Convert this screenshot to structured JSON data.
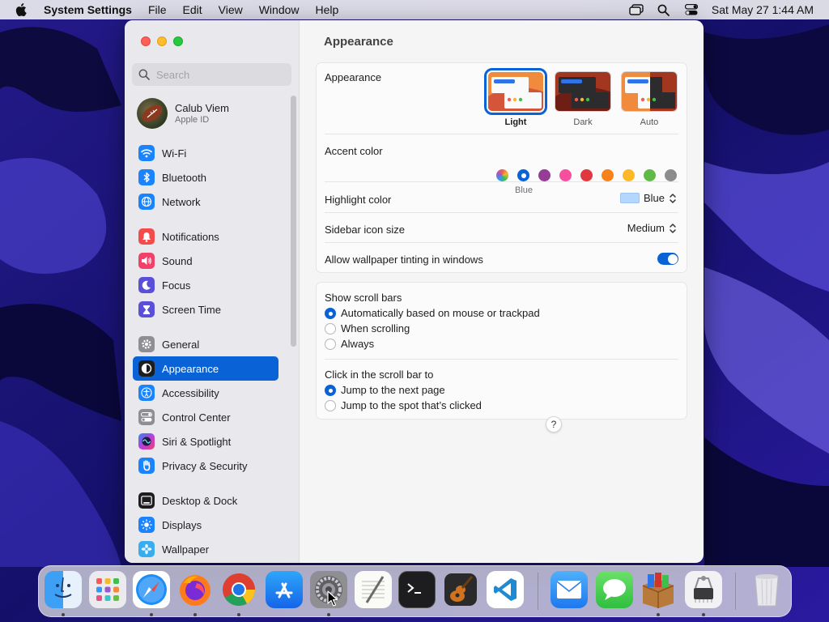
{
  "menubar": {
    "app_name": "System Settings",
    "menus": [
      "File",
      "Edit",
      "View",
      "Window",
      "Help"
    ],
    "clock": "Sat May 27  1:44 AM",
    "status_icons": [
      "window-icon",
      "search-icon",
      "control-center-icon"
    ]
  },
  "sidebar": {
    "search_placeholder": "Search",
    "profile": {
      "name": "Calub Viem",
      "subtitle": "Apple ID"
    },
    "items": [
      {
        "label": "Wi-Fi",
        "icon": "wifi-icon",
        "color": "#1a84ff"
      },
      {
        "label": "Bluetooth",
        "icon": "bluetooth-icon",
        "color": "#1a84ff"
      },
      {
        "label": "Network",
        "icon": "globe-icon",
        "color": "#1a84ff"
      },
      {
        "label": "Notifications",
        "icon": "bell-icon",
        "color": "#f44b4b"
      },
      {
        "label": "Sound",
        "icon": "speaker-icon",
        "color": "#f0416b"
      },
      {
        "label": "Focus",
        "icon": "moon-icon",
        "color": "#5a4fd8"
      },
      {
        "label": "Screen Time",
        "icon": "hourglass-icon",
        "color": "#5a4fd8"
      },
      {
        "label": "General",
        "icon": "gear-icon",
        "color": "#8e8e93"
      },
      {
        "label": "Appearance",
        "icon": "appearance-icon",
        "color": "#1d1d1f",
        "selected": true
      },
      {
        "label": "Accessibility",
        "icon": "accessibility-icon",
        "color": "#1a84ff"
      },
      {
        "label": "Control Center",
        "icon": "toggles-icon",
        "color": "#8e8e93"
      },
      {
        "label": "Siri & Spotlight",
        "icon": "siri-icon",
        "color": "#b83de0"
      },
      {
        "label": "Privacy & Security",
        "icon": "hand-icon",
        "color": "#1a84ff"
      },
      {
        "label": "Desktop & Dock",
        "icon": "dock-icon",
        "color": "#1d1d1f"
      },
      {
        "label": "Displays",
        "icon": "sun-icon",
        "color": "#1a84ff"
      },
      {
        "label": "Wallpaper",
        "icon": "flower-icon",
        "color": "#38aef0"
      }
    ]
  },
  "content": {
    "title": "Appearance",
    "appearance": {
      "label": "Appearance",
      "options": [
        {
          "label": "Light",
          "selected": true
        },
        {
          "label": "Dark",
          "selected": false
        },
        {
          "label": "Auto",
          "selected": false
        }
      ]
    },
    "accent": {
      "label": "Accent color",
      "selected_label": "Blue",
      "colors": [
        "multicolor",
        "#0a63d6",
        "#953d96",
        "#f74f9e",
        "#e0383e",
        "#f7821b",
        "#fcb827",
        "#62ba46",
        "#8c8c8c"
      ],
      "selected_index": 1
    },
    "highlight": {
      "label": "Highlight color",
      "value": "Blue",
      "swatch": "#b3d7ff"
    },
    "icon_size": {
      "label": "Sidebar icon size",
      "value": "Medium"
    },
    "tinting": {
      "label": "Allow wallpaper tinting in windows",
      "on": true
    },
    "scrollbars": {
      "label": "Show scroll bars",
      "options": [
        {
          "label": "Automatically based on mouse or trackpad",
          "selected": true
        },
        {
          "label": "When scrolling",
          "selected": false
        },
        {
          "label": "Always",
          "selected": false
        }
      ]
    },
    "click_scroll": {
      "label": "Click in the scroll bar to",
      "options": [
        {
          "label": "Jump to the next page",
          "selected": true
        },
        {
          "label": "Jump to the spot that’s clicked",
          "selected": false
        }
      ]
    },
    "help_label": "?"
  },
  "dock": {
    "apps": [
      {
        "name": "finder-icon",
        "running": true
      },
      {
        "name": "launchpad-icon",
        "running": false
      },
      {
        "name": "safari-icon",
        "running": true
      },
      {
        "name": "firefox-icon",
        "running": true
      },
      {
        "name": "chrome-icon",
        "running": true
      },
      {
        "name": "app-store-icon",
        "running": false
      },
      {
        "name": "system-settings-icon",
        "running": true
      },
      {
        "name": "textedit-icon",
        "running": false
      },
      {
        "name": "terminal-icon",
        "running": false
      },
      {
        "name": "garageband-icon",
        "running": false
      },
      {
        "name": "vscode-icon",
        "running": false
      },
      {
        "name": "mail-icon",
        "running": false
      },
      {
        "name": "messages-icon",
        "running": false
      },
      {
        "name": "archive-utility-icon",
        "running": true
      },
      {
        "name": "system-information-icon",
        "running": true
      },
      {
        "name": "trash-icon",
        "running": false
      }
    ]
  }
}
